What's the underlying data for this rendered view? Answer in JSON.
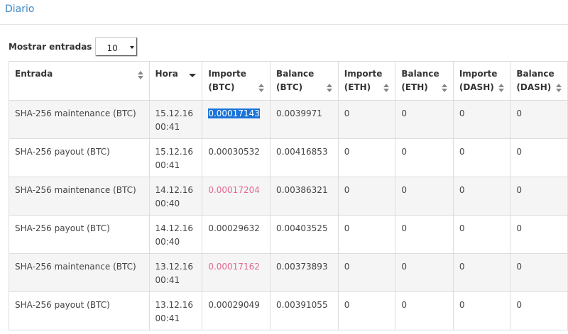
{
  "panel": {
    "title": "Diario"
  },
  "length": {
    "label": "Mostrar entradas",
    "value": "10"
  },
  "columns": [
    {
      "l1": "Entrada",
      "l2": ""
    },
    {
      "l1": "Hora",
      "l2": ""
    },
    {
      "l1": "Importe",
      "l2": "(BTC)"
    },
    {
      "l1": "Balance",
      "l2": "(BTC)"
    },
    {
      "l1": "Importe",
      "l2": "(ETH)"
    },
    {
      "l1": "Balance",
      "l2": "(ETH)"
    },
    {
      "l1": "Importe",
      "l2": "(DASH)"
    },
    {
      "l1": "Balance",
      "l2": "(DASH)"
    }
  ],
  "rows": [
    {
      "entrada": "SHA-256 maintenance (BTC)",
      "date": "15.12.16",
      "time": "00:41",
      "imp_btc": "0.00017143",
      "bal_btc": "0.0039971",
      "imp_eth": "0",
      "bal_eth": "0",
      "imp_dash": "0",
      "bal_dash": "0"
    },
    {
      "entrada": "SHA-256 payout (BTC)",
      "date": "15.12.16",
      "time": "00:41",
      "imp_btc": "0.00030532",
      "bal_btc": "0.00416853",
      "imp_eth": "0",
      "bal_eth": "0",
      "imp_dash": "0",
      "bal_dash": "0"
    },
    {
      "entrada": "SHA-256 maintenance (BTC)",
      "date": "14.12.16",
      "time": "00:40",
      "imp_btc": "0.00017204",
      "bal_btc": "0.00386321",
      "imp_eth": "0",
      "bal_eth": "0",
      "imp_dash": "0",
      "bal_dash": "0"
    },
    {
      "entrada": "SHA-256 payout (BTC)",
      "date": "14.12.16",
      "time": "00:40",
      "imp_btc": "0.00029632",
      "bal_btc": "0.00403525",
      "imp_eth": "0",
      "bal_eth": "0",
      "imp_dash": "0",
      "bal_dash": "0"
    },
    {
      "entrada": "SHA-256 maintenance (BTC)",
      "date": "13.12.16",
      "time": "00:41",
      "imp_btc": "0.00017162",
      "bal_btc": "0.00373893",
      "imp_eth": "0",
      "bal_eth": "0",
      "imp_dash": "0",
      "bal_dash": "0"
    },
    {
      "entrada": "SHA-256 payout (BTC)",
      "date": "13.12.16",
      "time": "00:41",
      "imp_btc": "0.00029049",
      "bal_btc": "0.00391055",
      "imp_eth": "0",
      "bal_eth": "0",
      "imp_dash": "0",
      "bal_dash": "0"
    }
  ],
  "colors": {
    "accent": "#3a87c8",
    "selection": "#1a73d9",
    "negative": "#e06b8f"
  }
}
